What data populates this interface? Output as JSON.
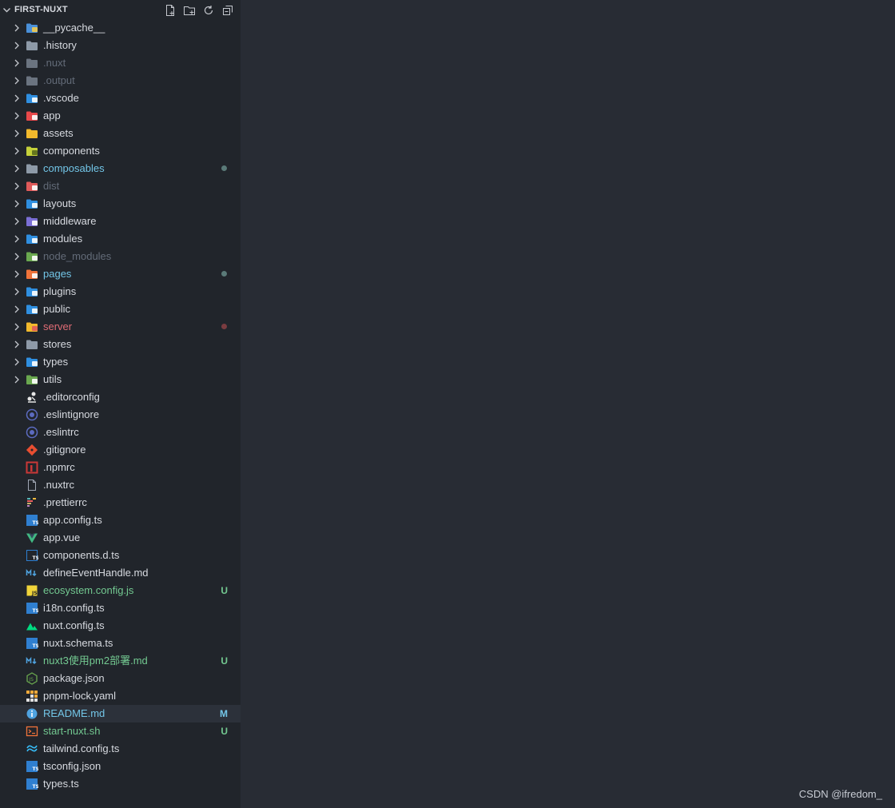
{
  "explorer": {
    "section_title": "FIRST-NUXT",
    "actions": [
      "new-file-icon",
      "new-folder-icon",
      "refresh-icon",
      "collapse-all-icon"
    ]
  },
  "folders": [
    {
      "label": "__pycache__",
      "icon": "python-folder-icon",
      "color": "#4a90d9",
      "accent": "#f2c94c",
      "state": "default"
    },
    {
      "label": ".history",
      "icon": "folder-icon",
      "color": "#8e9aa8",
      "accent": "",
      "state": "default"
    },
    {
      "label": ".nuxt",
      "icon": "folder-icon",
      "color": "#6b7480",
      "accent": "",
      "state": "ignored"
    },
    {
      "label": ".output",
      "icon": "folder-icon",
      "color": "#6b7480",
      "accent": "",
      "state": "ignored"
    },
    {
      "label": ".vscode",
      "icon": "vscode-folder-icon",
      "color": "#2f8fe0",
      "accent": "#ffffff",
      "state": "default"
    },
    {
      "label": "app",
      "icon": "app-folder-icon",
      "color": "#e8484a",
      "accent": "#ffffff",
      "state": "default"
    },
    {
      "label": "assets",
      "icon": "assets-folder-icon",
      "color": "#f2b92c",
      "accent": "",
      "state": "default"
    },
    {
      "label": "components",
      "icon": "components-folder-icon",
      "color": "#c5d13a",
      "accent": "#5a6b1c",
      "state": "default"
    },
    {
      "label": "composables",
      "icon": "folder-icon",
      "color": "#8e9aa8",
      "accent": "",
      "state": "modified",
      "dot": "#5a7a78"
    },
    {
      "label": "dist",
      "icon": "dist-folder-icon",
      "color": "#e05a5a",
      "accent": "#ffffff",
      "state": "ignored"
    },
    {
      "label": "layouts",
      "icon": "layouts-folder-icon",
      "color": "#2f8fe0",
      "accent": "#ffffff",
      "state": "default"
    },
    {
      "label": "middleware",
      "icon": "middleware-folder-icon",
      "color": "#7b6fd6",
      "accent": "#ffffff",
      "state": "default"
    },
    {
      "label": "modules",
      "icon": "modules-folder-icon",
      "color": "#2f8fe0",
      "accent": "#ffffff",
      "state": "default"
    },
    {
      "label": "node_modules",
      "icon": "node-folder-icon",
      "color": "#6aa84f",
      "accent": "#ffffff",
      "state": "ignored"
    },
    {
      "label": "pages",
      "icon": "pages-folder-icon",
      "color": "#f0733a",
      "accent": "#ffffff",
      "state": "modified",
      "dot": "#5a7a78"
    },
    {
      "label": "plugins",
      "icon": "plugins-folder-icon",
      "color": "#2f8fe0",
      "accent": "#ffffff",
      "state": "default"
    },
    {
      "label": "public",
      "icon": "public-folder-icon",
      "color": "#2f8fe0",
      "accent": "#ffffff",
      "state": "default"
    },
    {
      "label": "server",
      "icon": "server-folder-icon",
      "color": "#f2b92c",
      "accent": "#e05a5a",
      "state": "error",
      "dot": "#7a3c40"
    },
    {
      "label": "stores",
      "icon": "folder-icon",
      "color": "#8e9aa8",
      "accent": "",
      "state": "default"
    },
    {
      "label": "types",
      "icon": "types-folder-icon",
      "color": "#2f8fe0",
      "accent": "#ffffff",
      "state": "default"
    },
    {
      "label": "utils",
      "icon": "utils-folder-icon",
      "color": "#6aa84f",
      "accent": "#ffffff",
      "state": "default"
    }
  ],
  "files": [
    {
      "label": ".editorconfig",
      "icon": "editorconfig-icon",
      "color": "#e6e6e6",
      "state": "default"
    },
    {
      "label": ".eslintignore",
      "icon": "eslint-icon",
      "color": "#5c6bc0",
      "state": "default"
    },
    {
      "label": ".eslintrc",
      "icon": "eslint-icon",
      "color": "#5c6bc0",
      "state": "default"
    },
    {
      "label": ".gitignore",
      "icon": "git-icon",
      "color": "#e84e31",
      "state": "default"
    },
    {
      "label": ".npmrc",
      "icon": "npm-icon",
      "color": "#cb3837",
      "state": "default"
    },
    {
      "label": ".nuxtrc",
      "icon": "file-icon",
      "color": "#a0a7b4",
      "state": "default"
    },
    {
      "label": ".prettierrc",
      "icon": "prettier-icon",
      "color": "#c8b06a",
      "state": "default"
    },
    {
      "label": "app.config.ts",
      "icon": "typescript-icon",
      "color": "#2f7fd0",
      "state": "default"
    },
    {
      "label": "app.vue",
      "icon": "vue-icon",
      "color": "#41b883",
      "state": "default"
    },
    {
      "label": "components.d.ts",
      "icon": "typescript-def-icon",
      "color": "#2f7fd0",
      "state": "default"
    },
    {
      "label": "defineEventHandle.md",
      "icon": "markdown-icon",
      "color": "#4fa3e0",
      "state": "default"
    },
    {
      "label": "ecosystem.config.js",
      "icon": "javascript-icon",
      "color": "#f0d43a",
      "state": "new",
      "badge": "U"
    },
    {
      "label": "i18n.config.ts",
      "icon": "typescript-icon",
      "color": "#2f7fd0",
      "state": "default"
    },
    {
      "label": "nuxt.config.ts",
      "icon": "nuxt-icon",
      "color": "#00dc82",
      "state": "default"
    },
    {
      "label": "nuxt.schema.ts",
      "icon": "typescript-icon",
      "color": "#2f7fd0",
      "state": "default"
    },
    {
      "label": "nuxt3使用pm2部署.md",
      "icon": "markdown-icon",
      "color": "#4fa3e0",
      "state": "new",
      "badge": "U"
    },
    {
      "label": "package.json",
      "icon": "nodejs-icon",
      "color": "#6aa84f",
      "state": "default"
    },
    {
      "label": "pnpm-lock.yaml",
      "icon": "pnpm-icon",
      "color": "#f2a93a",
      "state": "default"
    },
    {
      "label": "README.md",
      "icon": "info-icon",
      "color": "#4fa3e0",
      "state": "modified",
      "badge": "M",
      "selected": true
    },
    {
      "label": "start-nuxt.sh",
      "icon": "shell-icon",
      "color": "#f0733a",
      "state": "new",
      "badge": "U"
    },
    {
      "label": "tailwind.config.ts",
      "icon": "tailwind-icon",
      "color": "#38bdf8",
      "state": "default"
    },
    {
      "label": "tsconfig.json",
      "icon": "tsconfig-icon",
      "color": "#2f7fd0",
      "state": "default"
    },
    {
      "label": "types.ts",
      "icon": "typescript-icon",
      "color": "#2f7fd0",
      "state": "default"
    }
  ],
  "status_colors": {
    "default": "#d7dae0",
    "ignored": "#636b78",
    "modified": "#73c6e8",
    "error": "#e06c75",
    "new": "#73c991"
  },
  "watermark": "CSDN @ifredom_"
}
